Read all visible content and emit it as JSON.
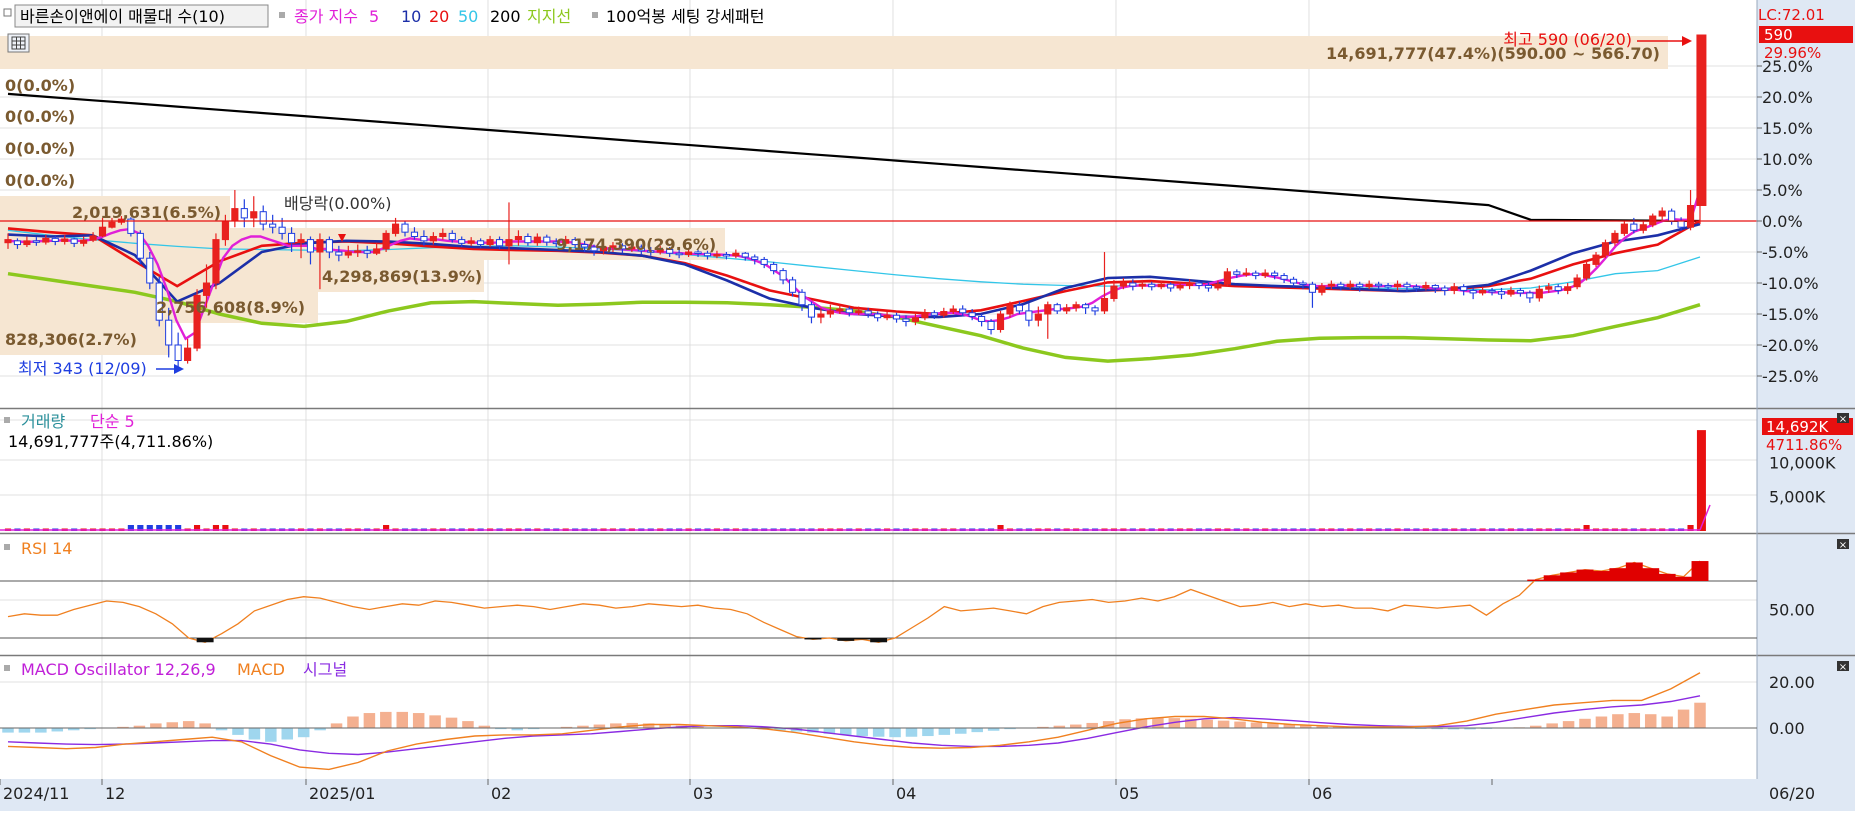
{
  "colors": {
    "up": "#e8211f",
    "down": "#1f3ee0",
    "ma5": "#e020d8",
    "ma10": "#1c2fa8",
    "ma20": "#e81010",
    "ma50": "#33c6e8",
    "ma200": "#000000",
    "support": "#8cc81e",
    "vol": "#e81010",
    "rsi": "#f08020",
    "macd": "#f08020",
    "signal": "#8a2be2",
    "band": "#f6e6d2",
    "axis_bg": "#dfe8f4",
    "grid": "#d8d8d8"
  },
  "main_legend": {
    "title": "바른손이앤에이 매물대 수(10)",
    "price_label": "종가 지수",
    "ma5": "5",
    "ma10": "10",
    "ma20": "20",
    "ma50": "50",
    "ma200": "200",
    "support": "지지선",
    "pattern": "100억봉 세팅 강세패턴"
  },
  "volume_legend": {
    "name": "거래량",
    "ma": "단순 5",
    "summary": "14,691,777주(4,711.86%)"
  },
  "rsi_legend": "RSI 14",
  "macd_legend": {
    "name": "MACD Oscillator 12,26,9",
    "macd": "MACD",
    "signal": "시그널"
  },
  "annotations": {
    "high": "최고 590 (06/20)",
    "low": "최저 343 (12/09)",
    "dividend": "배당락(0.00%)",
    "lc": "LC:72.01",
    "last_price": "590",
    "last_pct": "29.96%",
    "vol_badge": "14,692K",
    "vol_pct": "4711.86%"
  },
  "volume_profile": [
    "14,691,777(47.4%)(590.00 ~ 566.70)",
    "0(0.0%)",
    "0(0.0%)",
    "0(0.0%)",
    "0(0.0%)",
    "2,019,631(6.5%)",
    "9,174,390(29.6%)",
    "4,298,869(13.9%)",
    "2,756,608(8.9%)",
    "828,306(2.7%)"
  ],
  "chart_data": {
    "type": "candlestick",
    "x_labels": [
      "2024/11",
      "12",
      "2025/01",
      "02",
      "03",
      "04",
      "05",
      "06",
      "06/20"
    ],
    "price_axis": [
      "25.0%",
      "20.0%",
      "15.0%",
      "10.0%",
      "5.0%",
      "0.0%",
      "-5.0%",
      "-10.0%",
      "-15.0%",
      "-20.0%",
      "-25.0%"
    ],
    "price_axis_values": [
      25,
      20,
      15,
      10,
      5,
      0,
      -5,
      -10,
      -15,
      -20,
      -25
    ],
    "price_range_pct": [
      -30,
      30
    ],
    "volume_axis": [
      "10,000K",
      "5,000K"
    ],
    "volume_axis_values": [
      10000,
      5000
    ],
    "volume_max_k": 15000,
    "rsi_axis": [
      "50.00"
    ],
    "rsi_levels": [
      30,
      70
    ],
    "macd_axis": [
      "20.00",
      "0.00"
    ],
    "macd_axis_values": [
      20,
      0
    ],
    "macd_range": [
      -12,
      26
    ],
    "candles_pct": [
      [
        -3.5,
        -3,
        -2,
        -4.5
      ],
      [
        -3.2,
        -3.8,
        -2.8,
        -4.5
      ],
      [
        -3.8,
        -3.2,
        -2.5,
        -4.2
      ],
      [
        -3.2,
        -3.4,
        -2.6,
        -4
      ],
      [
        -3.4,
        -2.8,
        -2.2,
        -3.8
      ],
      [
        -2.8,
        -3.3,
        -2.4,
        -3.9
      ],
      [
        -3.3,
        -2.9,
        -2.3,
        -3.8
      ],
      [
        -2.9,
        -3.6,
        -2.7,
        -4.2
      ],
      [
        -3.6,
        -3.1,
        -2.5,
        -4.1
      ],
      [
        -3.1,
        -2.4,
        -1.8,
        -3.4
      ],
      [
        -2.4,
        -1,
        0.5,
        -2.6
      ],
      [
        -1,
        -0.2,
        0.5,
        -1.2
      ],
      [
        -0.2,
        0.3,
        0.8,
        -0.6
      ],
      [
        0.3,
        -2,
        0.6,
        -2.5
      ],
      [
        -2,
        -6,
        -1.5,
        -7
      ],
      [
        -6,
        -10,
        -5,
        -11
      ],
      [
        -10,
        -16,
        -9,
        -17
      ],
      [
        -16,
        -20,
        -14,
        -22
      ],
      [
        -20,
        -22.5,
        -18,
        -24
      ],
      [
        -22.5,
        -20.5,
        -19,
        -23
      ],
      [
        -20.5,
        -12,
        -11,
        -21
      ],
      [
        -12,
        -10,
        -7,
        -14
      ],
      [
        -10,
        -3,
        -2,
        -11
      ],
      [
        -3,
        0,
        1,
        -4
      ],
      [
        0,
        2,
        5,
        -1
      ],
      [
        2,
        0.5,
        3.5,
        -1
      ],
      [
        0.5,
        1.5,
        4,
        -1
      ],
      [
        1.5,
        -0.5,
        2.5,
        -1.5
      ],
      [
        -0.5,
        -1,
        1,
        -2
      ],
      [
        -1,
        -2,
        0.5,
        -3
      ],
      [
        -2,
        -3.5,
        -1,
        -5
      ],
      [
        -3.5,
        -3,
        -2,
        -6
      ],
      [
        -3,
        -5,
        -2.5,
        -7
      ],
      [
        -5,
        -3,
        -2,
        -11
      ],
      [
        -3,
        -5,
        -2.5,
        -6
      ],
      [
        -5,
        -5.5,
        -4,
        -6.5
      ],
      [
        -5.5,
        -5,
        -4,
        -6
      ],
      [
        -5,
        -4.8,
        -3.8,
        -5.8
      ],
      [
        -4.8,
        -5.2,
        -4,
        -6
      ],
      [
        -5.2,
        -4.5,
        -3.5,
        -5.5
      ],
      [
        -4.5,
        -2,
        -1.5,
        -5
      ],
      [
        -2,
        -0.5,
        0.5,
        -2.5
      ],
      [
        -0.5,
        -1.8,
        0,
        -2.5
      ],
      [
        -1.8,
        -2.5,
        -1,
        -3
      ],
      [
        -2.5,
        -3.2,
        -1.5,
        -4
      ],
      [
        -3.2,
        -2.5,
        -1.8,
        -3.8
      ],
      [
        -2.5,
        -2,
        -1.2,
        -3
      ],
      [
        -2,
        -3,
        -1.5,
        -3.5
      ],
      [
        -3,
        -3.6,
        -2.5,
        -4.2
      ],
      [
        -3.6,
        -3.2,
        -2.6,
        -4
      ],
      [
        -3.2,
        -3.8,
        -2.8,
        -4.4
      ],
      [
        -3.8,
        -3,
        -2.4,
        -4.2
      ],
      [
        -3,
        -4,
        -2.5,
        -4.6
      ],
      [
        -4,
        -3,
        3,
        -7
      ],
      [
        -3,
        -2.5,
        -1.5,
        -4
      ],
      [
        -2.5,
        -3.5,
        -2,
        -4
      ],
      [
        -3.5,
        -2.6,
        -2,
        -4
      ],
      [
        -2.6,
        -3.4,
        -2.2,
        -4
      ],
      [
        -3.4,
        -3.6,
        -2.8,
        -4.2
      ],
      [
        -3.6,
        -3,
        -2.4,
        -4
      ],
      [
        -3,
        -3.8,
        -2.6,
        -4.4
      ],
      [
        -3.8,
        -4.2,
        -3.2,
        -5
      ],
      [
        -4.2,
        -4.8,
        -3.8,
        -5.6
      ],
      [
        -4.8,
        -4.2,
        -3.6,
        -5.4
      ],
      [
        -4.2,
        -4,
        -3.4,
        -5
      ],
      [
        -4,
        -4.5,
        -3.6,
        -5.2
      ],
      [
        -4.5,
        -4.2,
        -3.6,
        -5
      ],
      [
        -4.2,
        -4.8,
        -3.8,
        -5.4
      ],
      [
        -4.8,
        -5,
        -4.2,
        -5.6
      ],
      [
        -5,
        -4.6,
        -4,
        -5.4
      ],
      [
        -4.6,
        -5.2,
        -4.2,
        -5.8
      ],
      [
        -5.2,
        -5.4,
        -4.6,
        -6
      ],
      [
        -5.4,
        -5,
        -4.4,
        -5.8
      ],
      [
        -5,
        -5.2,
        -4.6,
        -5.8
      ],
      [
        -5.2,
        -5.6,
        -4.8,
        -6.2
      ],
      [
        -5.6,
        -5.4,
        -4.8,
        -6
      ],
      [
        -5.4,
        -5.6,
        -5,
        -6.2
      ],
      [
        -5.6,
        -5.2,
        -4.6,
        -6
      ],
      [
        -5.2,
        -5.8,
        -5,
        -6.4
      ],
      [
        -5.8,
        -6.2,
        -5.4,
        -7
      ],
      [
        -6.2,
        -7,
        -5.8,
        -7.6
      ],
      [
        -7,
        -8,
        -6.6,
        -8.6
      ],
      [
        -8,
        -9.5,
        -7.6,
        -10.2
      ],
      [
        -9.5,
        -11.5,
        -9,
        -12.2
      ],
      [
        -11.5,
        -13.5,
        -11,
        -14.5
      ],
      [
        -13.5,
        -15.5,
        -13,
        -16.5
      ],
      [
        -15.5,
        -15,
        -14,
        -16.5
      ],
      [
        -15,
        -14.5,
        -13.5,
        -15.6
      ],
      [
        -14.5,
        -14.2,
        -13.5,
        -15
      ],
      [
        -14.2,
        -14.8,
        -13.8,
        -15.4
      ],
      [
        -14.8,
        -14.5,
        -13.8,
        -15.2
      ],
      [
        -14.5,
        -15,
        -14,
        -15.6
      ],
      [
        -15,
        -15.6,
        -14.6,
        -16.2
      ],
      [
        -15.6,
        -15.2,
        -14.6,
        -16
      ],
      [
        -15.2,
        -15.8,
        -14.8,
        -16.4
      ],
      [
        -15.8,
        -16.2,
        -15.2,
        -17
      ],
      [
        -16.2,
        -15.6,
        -15,
        -16.8
      ],
      [
        -15.6,
        -14.8,
        -14.2,
        -16
      ],
      [
        -14.8,
        -15.2,
        -14.4,
        -15.8
      ],
      [
        -15.2,
        -14.6,
        -14,
        -15.6
      ],
      [
        -14.6,
        -14.2,
        -13.6,
        -15
      ],
      [
        -14.2,
        -14.8,
        -13.6,
        -15.4
      ],
      [
        -14.8,
        -15.4,
        -14.2,
        -16
      ],
      [
        -15.4,
        -16.2,
        -15,
        -17
      ],
      [
        -16.2,
        -17.5,
        -15.8,
        -18.3
      ],
      [
        -17.5,
        -15,
        -14.5,
        -18
      ],
      [
        -15,
        -13.6,
        -13,
        -15.6
      ],
      [
        -13.6,
        -14.5,
        -13,
        -15
      ],
      [
        -14.5,
        -16,
        -13.2,
        -17
      ],
      [
        -16,
        -15,
        -13.8,
        -17
      ],
      [
        -15,
        -13.5,
        -13,
        -19
      ],
      [
        -13.5,
        -14.5,
        -13.2,
        -15
      ],
      [
        -14.5,
        -14,
        -13.4,
        -15
      ],
      [
        -14,
        -13.5,
        -13,
        -14.6
      ],
      [
        -13.5,
        -14,
        -13.2,
        -15
      ],
      [
        -14,
        -14.5,
        -13.6,
        -15.2
      ],
      [
        -14.5,
        -12.5,
        -5,
        -15
      ],
      [
        -12.5,
        -10.5,
        -9.5,
        -13
      ],
      [
        -10.5,
        -10,
        -9.2,
        -11
      ],
      [
        -10,
        -10.5,
        -9.4,
        -11.2
      ],
      [
        -10.5,
        -10.2,
        -9.5,
        -11
      ],
      [
        -10.2,
        -10.6,
        -9.8,
        -11.2
      ],
      [
        -10.6,
        -10.2,
        -9.6,
        -11
      ],
      [
        -10.2,
        -10.8,
        -9.9,
        -11.4
      ],
      [
        -10.8,
        -10.4,
        -9.8,
        -11.2
      ],
      [
        -10.4,
        -10,
        -9.4,
        -11
      ],
      [
        -10,
        -10.4,
        -9.6,
        -11
      ],
      [
        -10.4,
        -10.8,
        -10,
        -11.4
      ],
      [
        -10.8,
        -10.2,
        -9.6,
        -11.2
      ],
      [
        -10.2,
        -8.2,
        -7.6,
        -10.6
      ],
      [
        -8.2,
        -8.6,
        -7.8,
        -9.2
      ],
      [
        -8.6,
        -8.4,
        -7.6,
        -9
      ],
      [
        -8.4,
        -8.8,
        -8,
        -9.4
      ],
      [
        -8.8,
        -8.4,
        -7.8,
        -9.2
      ],
      [
        -8.4,
        -8.8,
        -8,
        -9.4
      ],
      [
        -8.8,
        -9.4,
        -8.4,
        -10
      ],
      [
        -9.4,
        -10,
        -9,
        -10.6
      ],
      [
        -10,
        -10.2,
        -9.6,
        -11
      ],
      [
        -10.2,
        -11.5,
        -9.8,
        -14
      ],
      [
        -11.5,
        -10.5,
        -10,
        -12
      ],
      [
        -10.5,
        -10.2,
        -9.6,
        -11
      ],
      [
        -10.2,
        -10.6,
        -9.8,
        -11.2
      ],
      [
        -10.6,
        -10.2,
        -9.6,
        -11
      ],
      [
        -10.2,
        -10.6,
        -9.8,
        -11.4
      ],
      [
        -10.6,
        -10.2,
        -9.6,
        -11
      ],
      [
        -10.2,
        -10.4,
        -9.8,
        -11
      ],
      [
        -10.4,
        -10.6,
        -10,
        -11.2
      ],
      [
        -10.6,
        -10.2,
        -9.6,
        -11.2
      ],
      [
        -10.2,
        -10.6,
        -9.8,
        -11.4
      ],
      [
        -10.6,
        -10.8,
        -10.2,
        -11.4
      ],
      [
        -10.8,
        -10.4,
        -9.8,
        -11.2
      ],
      [
        -10.4,
        -10.8,
        -10.2,
        -11.6
      ],
      [
        -10.8,
        -11.2,
        -10.4,
        -12
      ],
      [
        -11.2,
        -10.6,
        -10,
        -11.8
      ],
      [
        -10.6,
        -11.2,
        -10.2,
        -12
      ],
      [
        -11.2,
        -11.6,
        -10.8,
        -12.6
      ],
      [
        -11.6,
        -11.2,
        -10.6,
        -12
      ],
      [
        -11.2,
        -11.4,
        -10.8,
        -12
      ],
      [
        -11.4,
        -11.8,
        -10.8,
        -12.6
      ],
      [
        -11.8,
        -11.2,
        -10.6,
        -12.2
      ],
      [
        -11.2,
        -11.6,
        -10.8,
        -12.2
      ],
      [
        -11.6,
        -12.4,
        -11.2,
        -13.2
      ],
      [
        -12.4,
        -11,
        -10.4,
        -13
      ],
      [
        -11,
        -10.6,
        -10,
        -11.6
      ],
      [
        -10.6,
        -11.2,
        -10.2,
        -11.8
      ],
      [
        -11.2,
        -10.6,
        -10,
        -11.8
      ],
      [
        -10.6,
        -9.2,
        -8.6,
        -11
      ],
      [
        -9.2,
        -7,
        -6.4,
        -9.6
      ],
      [
        -7,
        -5.5,
        -5,
        -7.4
      ],
      [
        -5.5,
        -3.5,
        -3,
        -6
      ],
      [
        -3.5,
        -2,
        -1.5,
        -4
      ],
      [
        -2,
        -0.5,
        0,
        -2.4
      ],
      [
        -0.5,
        -1.5,
        0.5,
        -2
      ],
      [
        -1.5,
        -0.6,
        0,
        -2
      ],
      [
        -0.6,
        0.8,
        1.2,
        -1
      ],
      [
        0.8,
        1.6,
        2.2,
        0.2
      ],
      [
        1.6,
        0,
        2,
        -0.6
      ],
      [
        0,
        -1,
        0.6,
        -1.6
      ],
      [
        -1,
        2.5,
        5,
        -1.5
      ],
      [
        2.5,
        30,
        30,
        -0.5
      ]
    ],
    "ma5_pct": [
      -3.2,
      -3.3,
      -3.4,
      -3.3,
      -3.2,
      -3.2,
      -3.1,
      -3.2,
      -3.2,
      -3,
      -2.6,
      -2,
      -1.5,
      -1.3,
      -2,
      -4,
      -7,
      -11,
      -16,
      -19,
      -18,
      -14,
      -10,
      -6,
      -4,
      -3,
      -2.5,
      -2.5,
      -3,
      -3.5,
      -4,
      -4,
      -4,
      -4.5,
      -4.5,
      -4.7,
      -4.8,
      -5,
      -5,
      -5,
      -4.5,
      -3.8,
      -3.2,
      -2.8,
      -3,
      -3,
      -3,
      -3.2,
      -3.3,
      -3.4,
      -3.5,
      -3.5,
      -3.5,
      -3.4,
      -3.3,
      -3.3,
      -3.3,
      -3.3,
      -3.3,
      -3.3,
      -3.4,
      -3.6,
      -3.9,
      -4.2,
      -4.4,
      -4.5,
      -4.6,
      -4.7,
      -4.8,
      -4.9,
      -5,
      -5.1,
      -5.2,
      -5.3,
      -5.3,
      -5.4,
      -5.4,
      -5.5,
      -5.6,
      -5.9,
      -6.4,
      -7,
      -8,
      -9,
      -10.5,
      -12,
      -13,
      -14,
      -14.5,
      -14.8,
      -15,
      -15,
      -15,
      -15,
      -15.2,
      -15.4,
      -15.5,
      -15.4,
      -15.2,
      -15,
      -14.8,
      -14.8,
      -15,
      -15.4,
      -16,
      -16.2,
      -16,
      -15.6,
      -15,
      -14.8,
      -14.6,
      -14.4,
      -14.2,
      -14.2,
      -14,
      -13.8,
      -13.2,
      -12.2,
      -11.4,
      -10.8,
      -10.5,
      -10.4,
      -10.4,
      -10.4,
      -10.4,
      -10.3,
      -10.3,
      -10.3,
      -10.3,
      -9.9,
      -9.5,
      -9.1,
      -8.8,
      -8.6,
      -8.6,
      -8.9,
      -9.2,
      -9.6,
      -10,
      -10.3,
      -10.5,
      -10.5,
      -10.4,
      -10.4,
      -10.4,
      -10.4,
      -10.5,
      -10.5,
      -10.5,
      -10.5,
      -10.5,
      -10.6,
      -10.8,
      -10.9,
      -11,
      -11.1,
      -11.3,
      -11.4,
      -11.4,
      -11.5,
      -11.5,
      -11.6,
      -11.6,
      -11.6,
      -11.6,
      -11.4,
      -11.2,
      -10.8,
      -10.2,
      -9,
      -7.5,
      -5.8,
      -4,
      -2.7,
      -1.7,
      -1.2,
      -0.6,
      0,
      0.3,
      0.2,
      0.2,
      5
    ]
  },
  "x_tick_x": [
    0,
    102,
    306,
    488,
    690,
    893,
    1116,
    1309,
    1492
  ]
}
